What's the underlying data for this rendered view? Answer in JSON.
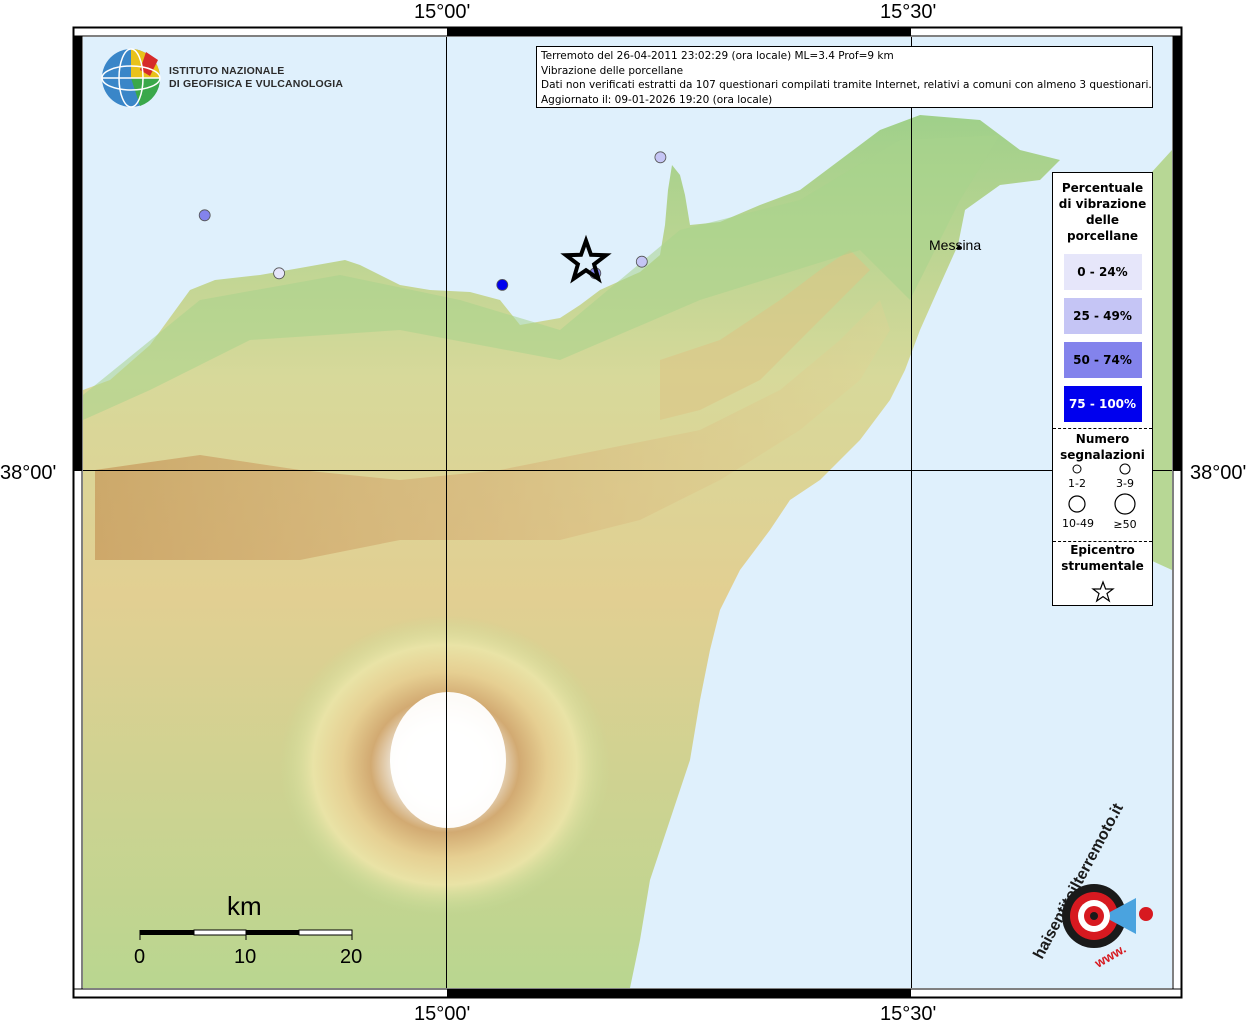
{
  "info": {
    "line1": "Terremoto del 26-04-2011 23:02:29 (ora locale) ML=3.4 Prof=9 km",
    "line2": "Vibrazione delle porcellane",
    "line3": "Dati non verificati estratti da 107 questionari compilati tramite Internet, relativi a comuni con almeno 3 questionari.",
    "line4": "Aggiornato il: 09-01-2026 19:20 (ora locale)"
  },
  "logo": {
    "line1": "ISTITUTO NAZIONALE",
    "line2": "DI GEOFISICA E VULCANOLOGIA"
  },
  "axes": {
    "top_left": "15°00'",
    "top_right": "15°30'",
    "bottom_left": "15°00'",
    "bottom_right": "15°30'",
    "left_lat": "38°00'",
    "right_lat": "38°00'"
  },
  "city": {
    "name": "Messina"
  },
  "scale": {
    "title": "km",
    "labels": [
      "0",
      "10",
      "20"
    ]
  },
  "legend": {
    "pct_title": "Percentuale di vibrazione delle porcellane",
    "classes": [
      {
        "label": "0 - 24%",
        "color": "#e6e6fa",
        "text": "#000000"
      },
      {
        "label": "25 - 49%",
        "color": "#c5c5f5",
        "text": "#000000"
      },
      {
        "label": "50 - 74%",
        "color": "#8383ec",
        "text": "#000000"
      },
      {
        "label": "75 - 100%",
        "color": "#0000ee",
        "text": "#ffffff"
      }
    ],
    "count_title": "Numero segnalazioni",
    "counts": [
      "1-2",
      "3-9",
      "10-49",
      "≥50"
    ],
    "epi_title": "Epicentro strumentale"
  },
  "points": [
    {
      "lon": 14.74,
      "lat": 38.22,
      "pct_class": 2
    },
    {
      "lon": 14.82,
      "lat": 38.17,
      "pct_class": 0
    },
    {
      "lon": 15.06,
      "lat": 38.16,
      "pct_class": 3
    },
    {
      "lon": 15.16,
      "lat": 38.17,
      "pct_class": 2
    },
    {
      "lon": 15.21,
      "lat": 38.18,
      "pct_class": 1
    },
    {
      "lon": 15.23,
      "lat": 38.27,
      "pct_class": 1
    }
  ],
  "epicenter": {
    "lon": 15.15,
    "lat": 38.18
  },
  "site_logo": {
    "text": "haisentitoilterremoto.it",
    "sub": "www."
  },
  "colors": {
    "sea": "#dff0fc",
    "land_low": "#8fc97e",
    "land_mid": "#e6dc9c",
    "land_high": "#c99a58",
    "summit": "#ffffff"
  }
}
